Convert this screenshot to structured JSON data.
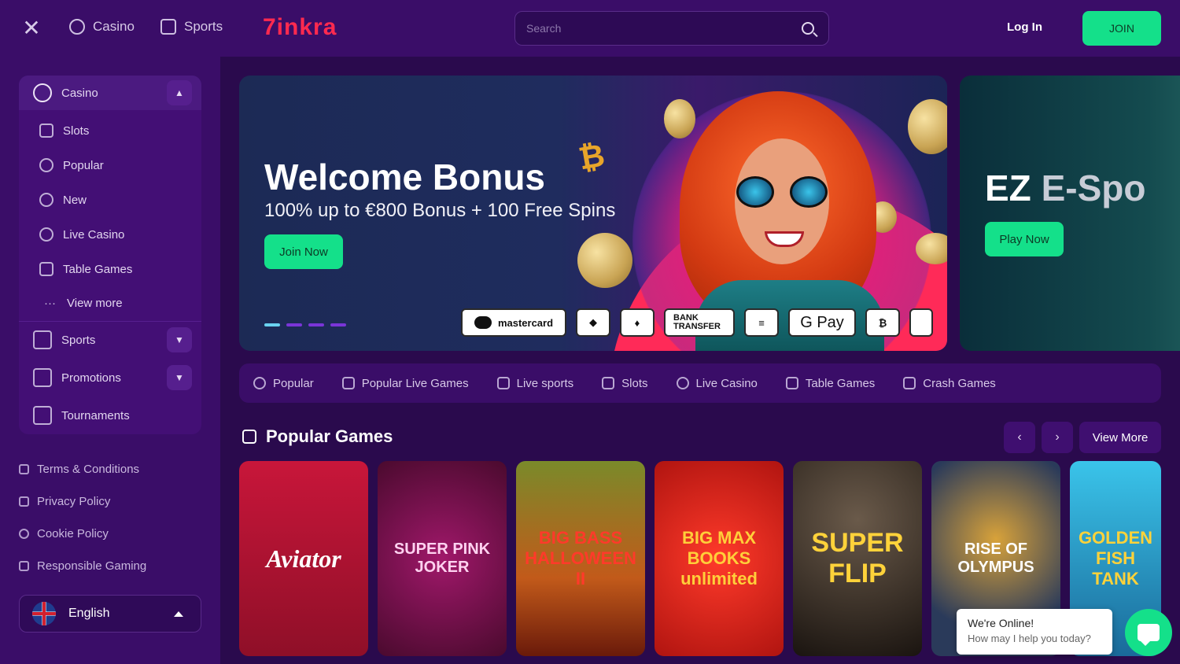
{
  "topbar": {
    "nav": [
      {
        "label": "Casino",
        "icon": "casino-chip-icon"
      },
      {
        "label": "Sports",
        "icon": "jersey-icon"
      }
    ],
    "logo": "7inkra",
    "search_placeholder": "Search",
    "login_label": "Log In",
    "join_label": "JOIN"
  },
  "sidebar": {
    "casino_label": "Casino",
    "items": [
      {
        "label": "Slots",
        "icon": "slot-machine-icon"
      },
      {
        "label": "Popular",
        "icon": "flame-icon"
      },
      {
        "label": "New",
        "icon": "new-badge-icon"
      },
      {
        "label": "Live Casino",
        "icon": "live-chip-icon"
      },
      {
        "label": "Table Games",
        "icon": "cards-icon"
      }
    ],
    "view_more": "View more",
    "sections": [
      {
        "label": "Sports",
        "icon": "jersey-icon"
      },
      {
        "label": "Promotions",
        "icon": "rocket-icon"
      },
      {
        "label": "Tournaments",
        "icon": "trophy-icon"
      }
    ],
    "footer_links": [
      {
        "label": "Terms & Conditions",
        "icon": "document-icon"
      },
      {
        "label": "Privacy Policy",
        "icon": "shield-icon"
      },
      {
        "label": "Cookie Policy",
        "icon": "cookie-icon"
      },
      {
        "label": "Responsible Gaming",
        "icon": "people-icon"
      }
    ],
    "language": "English"
  },
  "hero": {
    "title": "Welcome Bonus",
    "title_symbol": "₿",
    "subtitle": "100% up to €800 Bonus + 100 Free Spins",
    "cta": "Join Now",
    "payments": [
      "mastercard",
      "BANK TRANSFER",
      "G Pay"
    ],
    "active_slide": 1,
    "slide_count": 4
  },
  "hero2": {
    "title_a": "EZ",
    "title_b": "E-Spo",
    "cta": "Play Now"
  },
  "categories": [
    {
      "label": "Popular",
      "icon": "flame-icon"
    },
    {
      "label": "Popular Live Games",
      "icon": "cards-icon"
    },
    {
      "label": "Live sports",
      "icon": "calendar-icon"
    },
    {
      "label": "Slots",
      "icon": "slot-machine-icon"
    },
    {
      "label": "Live Casino",
      "icon": "chip-icon"
    },
    {
      "label": "Table Games",
      "icon": "cards-icon"
    },
    {
      "label": "Crash Games",
      "icon": "crash-chart-icon"
    }
  ],
  "popular": {
    "title": "Popular Games",
    "view_more": "View More",
    "games": [
      {
        "name": "Aviator",
        "color": "#b5142e"
      },
      {
        "name": "SUPER PINK JOKER",
        "color": "#6b0f3c"
      },
      {
        "name": "BIG BASS HALLOWEEN II",
        "color": "#b0641a"
      },
      {
        "name": "BIG MAX BOOKS unlimited",
        "color": "#d82418"
      },
      {
        "name": "SUPER FLIP",
        "color": "#3a2a2a"
      },
      {
        "name": "RISE OF OLYMPUS",
        "color": "#2a3a5a"
      },
      {
        "name": "GOLDEN FISH TANK",
        "color": "#1a8ab0"
      }
    ]
  },
  "chat": {
    "line1": "We're Online!",
    "line2": "How may I help you today?"
  },
  "colors": {
    "accent_green": "#14e08a",
    "brand_red": "#ff2a4f",
    "bg_purple": "#2a0a4d",
    "panel_purple": "#3a0d68"
  }
}
